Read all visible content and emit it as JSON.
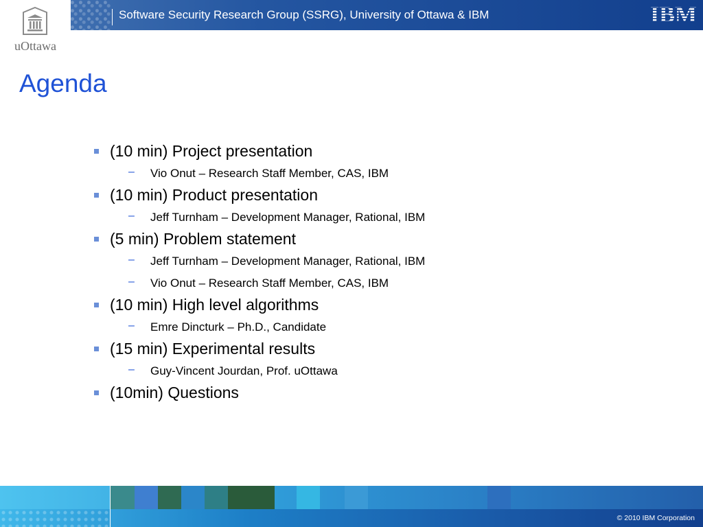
{
  "header": {
    "logo_text": "uOttawa",
    "title": "Software Security Research Group (SSRG), University of Ottawa & IBM",
    "ibm_logo": "IBM"
  },
  "slide": {
    "title": "Agenda",
    "items": [
      {
        "text": "(10 min) Project presentation",
        "subs": [
          "Vio Onut – Research Staff Member, CAS, IBM"
        ]
      },
      {
        "text": "(10 min) Product presentation",
        "subs": [
          "Jeff Turnham – Development Manager, Rational, IBM"
        ]
      },
      {
        "text": "(5 min)   Problem statement",
        "subs": [
          "Jeff Turnham – Development Manager, Rational, IBM",
          "Vio Onut – Research Staff Member, CAS, IBM"
        ]
      },
      {
        "text": "(10 min) High level algorithms",
        "subs": [
          "Emre Dincturk – Ph.D., Candidate"
        ]
      },
      {
        "text": "(15 min) Experimental results",
        "subs": [
          "Guy-Vincent Jourdan, Prof. uOttawa"
        ]
      },
      {
        "text": "(10min)  Questions",
        "subs": []
      }
    ]
  },
  "footer": {
    "copyright": "© 2010 IBM Corporation"
  },
  "colors": {
    "title": "#1f52d6",
    "bullet": "#6a8fd8",
    "dash": "#1f52d6",
    "header_band": "#123f8d"
  },
  "icons": {
    "logo": "university-building-icon",
    "bullet": "square-bullet-icon",
    "sub_bullet": "dash-icon"
  }
}
